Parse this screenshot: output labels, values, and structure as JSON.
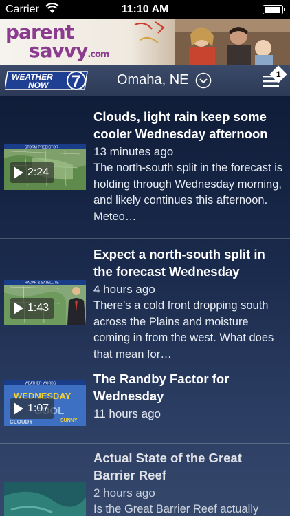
{
  "status_bar": {
    "carrier": "Carrier",
    "time": "11:10 AM",
    "battery_level": 0.95
  },
  "ad": {
    "brand_line1": "parent",
    "brand_line2": "savvy",
    "brand_suffix": ".com"
  },
  "header": {
    "location": "Omaha, NE",
    "logo_text_1": "WEATHER",
    "logo_text_2": "NOW",
    "logo_number": "7",
    "menu_badge": "1"
  },
  "stories": [
    {
      "title": "Clouds, light rain keep some cooler Wednesday afternoon",
      "time": "13 minutes ago",
      "summary": "The north-south split in the forecast is holding through Wednesday morning, and likely continues this afternoon. Meteo…",
      "duration": "2:24",
      "thumb_caption": "STORM PREDICTOR"
    },
    {
      "title": "Expect a north-south split in the forecast Wednesday",
      "time": "4 hours ago",
      "summary": "There's a cold front dropping south across the Plains and moisture coming in from the west. What does that mean for…",
      "duration": "1:43",
      "thumb_caption": "RADAR & SATELLITE"
    },
    {
      "title": "The Randby Factor for Wednesday",
      "time": "11 hours ago",
      "summary": "",
      "duration": "1:07",
      "thumb_caption": "WEATHER WORDS",
      "thumb_words": [
        "WEDNESDAY",
        "COOL",
        "CLOUDY",
        "SUNNY"
      ]
    },
    {
      "title": "Actual State of the Great Barrier Reef",
      "time": "2 hours ago",
      "summary": "Is the Great Barrier Reef actually",
      "duration": "",
      "thumb_caption": ""
    }
  ],
  "colors": {
    "accent_logo_red": "#d0202a",
    "logo_blue": "#1f3f93",
    "brand_purple": "#8c3c8e"
  }
}
